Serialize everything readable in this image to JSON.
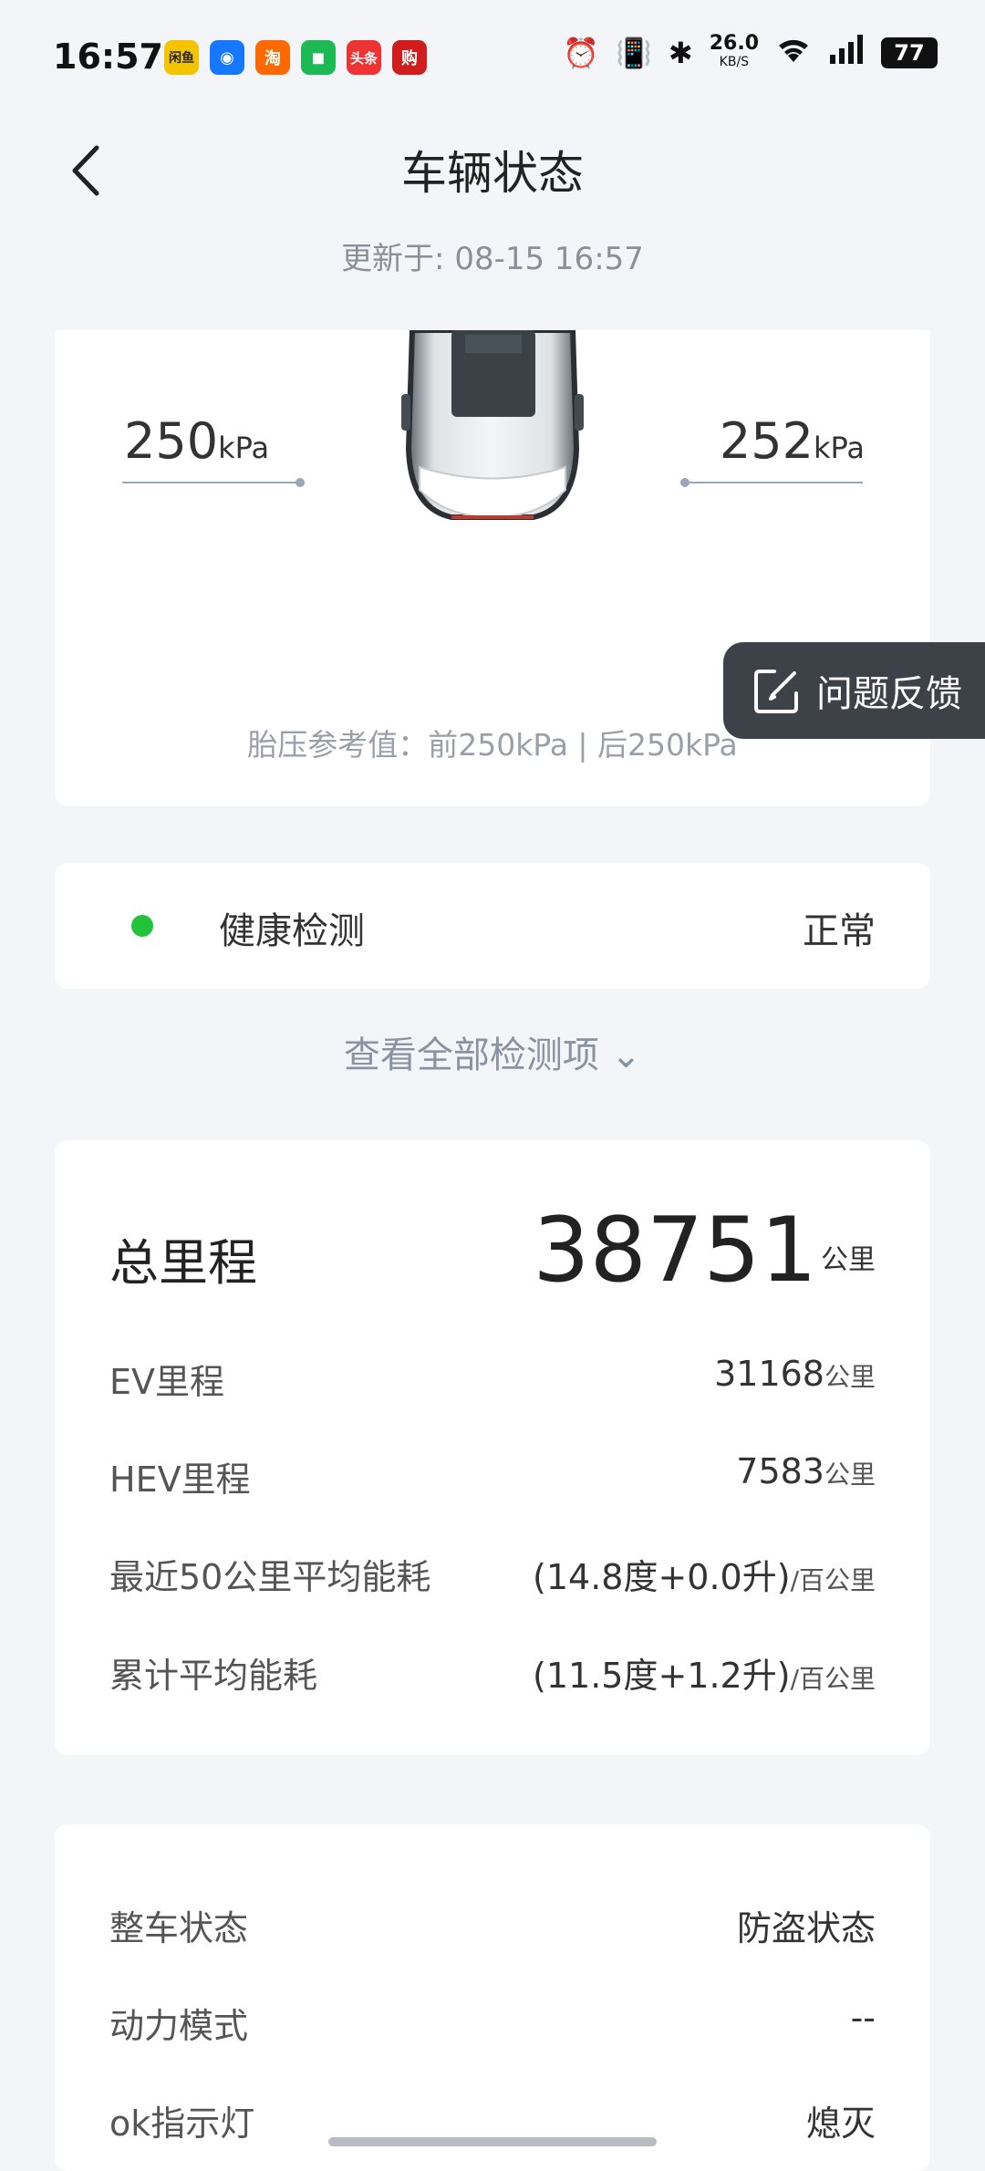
{
  "status_bar": {
    "time": "16:57",
    "apps": [
      {
        "label": "闲鱼",
        "color": "#f5c400"
      },
      {
        "label": "◉",
        "color": "#1678ff"
      },
      {
        "label": "淘",
        "color": "#ff6a00"
      },
      {
        "label": "◼",
        "color": "#1db954"
      },
      {
        "label": "头条",
        "color": "#e33"
      },
      {
        "label": "购",
        "color": "#d01c1c"
      }
    ],
    "speed": "26.0",
    "speed_unit": "KB/S",
    "battery": "77"
  },
  "header": {
    "title": "车辆状态",
    "updated": "更新于: 08-15 16:57"
  },
  "tires": {
    "front_left": "250",
    "front_right": "252",
    "unit": "kPa",
    "reference": "胎压参考值：前250kPa | 后250kPa"
  },
  "feedback": {
    "label": "问题反馈"
  },
  "health": {
    "label": "健康检测",
    "status": "正常",
    "status_color": "#22c33b",
    "view_all": "查看全部检测项 ⌄"
  },
  "mileage": {
    "total_label": "总里程",
    "total_value": "38751",
    "unit": "公里",
    "rows": [
      {
        "label": "EV里程",
        "value": "31168",
        "unit": "公里"
      },
      {
        "label": "HEV里程",
        "value": "7583",
        "unit": "公里"
      },
      {
        "label": "最近50公里平均能耗",
        "value": "(14.8度+0.0升)",
        "unit": "/百公里"
      },
      {
        "label": "累计平均能耗",
        "value": "(11.5度+1.2升)",
        "unit": "/百公里"
      }
    ]
  },
  "vehicle_state": {
    "rows": [
      {
        "label": "整车状态",
        "value": "防盗状态"
      },
      {
        "label": "动力模式",
        "value": "--"
      },
      {
        "label": "ok指示灯",
        "value": "熄灭"
      }
    ]
  }
}
